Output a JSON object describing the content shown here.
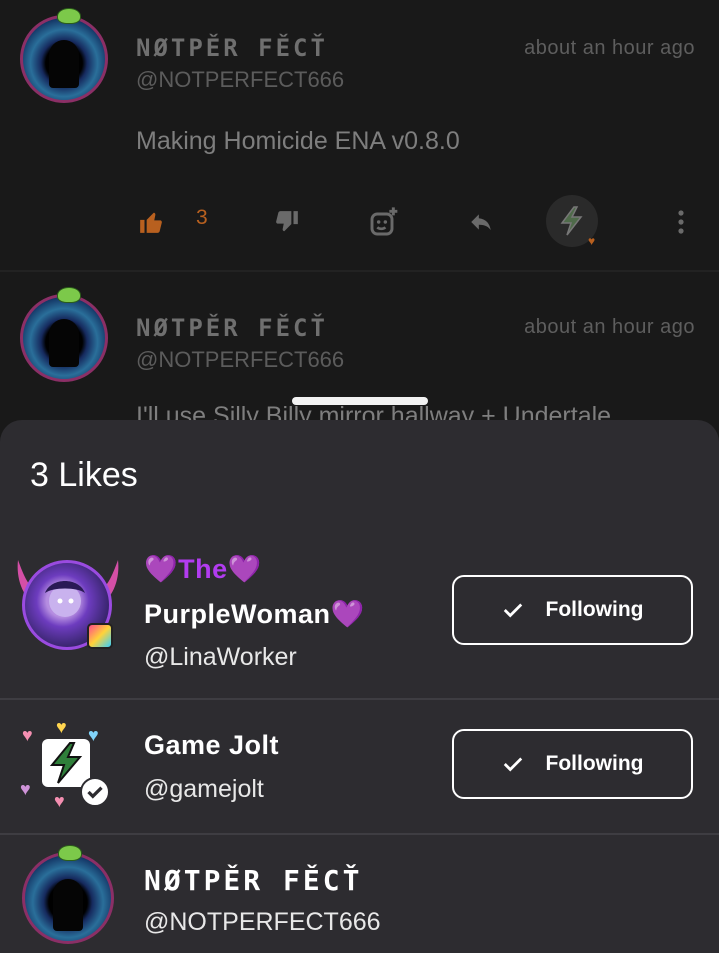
{
  "feed": {
    "posts": [
      {
        "author_name": "NØTPĚR FĚCŤ",
        "author_handle": "@NOTPERFECT666",
        "time": "about an hour ago",
        "body": "Making Homicide ENA v0.8.0",
        "like_count": "3"
      },
      {
        "author_name": "NØTPĚR FĚCŤ",
        "author_handle": "@NOTPERFECT666",
        "time": "about an hour ago",
        "body": "I'll use Silly Billy mirror hallway + Undertale"
      }
    ]
  },
  "likes_sheet": {
    "title": "3 Likes",
    "users": [
      {
        "name_line1": "💜The💜",
        "name_line2": "PurpleWoman💜",
        "handle": "@LinaWorker",
        "follow_label": "Following"
      },
      {
        "name_line1": "Game Jolt",
        "handle": "@gamejolt",
        "follow_label": "Following"
      },
      {
        "name_line1": "NØTPĚR FĚCŤ",
        "handle": "@NOTPERFECT666"
      }
    ]
  },
  "colors": {
    "accent_like": "#b8601f",
    "follow_border": "#ffffff",
    "sheet_bg": "#2d2c30"
  },
  "icons": [
    "thumbs-up-icon",
    "thumbs-down-icon",
    "sticker-add-icon",
    "reply-icon",
    "gamejolt-bolt-icon",
    "more-vertical-icon",
    "check-icon",
    "verified-icon"
  ]
}
